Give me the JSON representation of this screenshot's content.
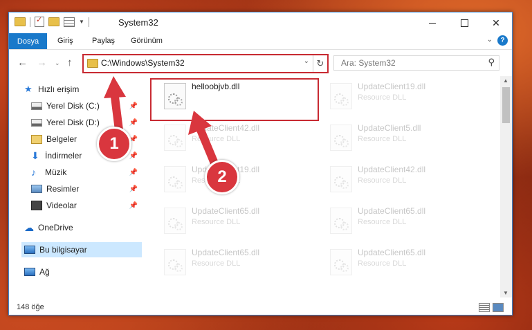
{
  "window": {
    "title": "System32"
  },
  "ribbon": {
    "file_tab": "Dosya",
    "tabs": [
      "Giriş",
      "Paylaş",
      "Görünüm"
    ]
  },
  "address": {
    "path": "C:\\Windows\\System32"
  },
  "search": {
    "placeholder": "Ara: System32"
  },
  "sidebar": {
    "items": [
      {
        "label": "Hızlı erişim",
        "icon": "star-icon",
        "pinned": false
      },
      {
        "label": "Yerel Disk (C:)",
        "icon": "drive-icon",
        "pinned": true
      },
      {
        "label": "Yerel Disk (D:)",
        "icon": "drive-icon",
        "pinned": true
      },
      {
        "label": "Belgeler",
        "icon": "documents-icon",
        "pinned": true
      },
      {
        "label": "İndirmeler",
        "icon": "download-icon",
        "pinned": true
      },
      {
        "label": "Müzik",
        "icon": "music-icon",
        "pinned": true
      },
      {
        "label": "Resimler",
        "icon": "pictures-icon",
        "pinned": true
      },
      {
        "label": "Videolar",
        "icon": "videos-icon",
        "pinned": true
      },
      {
        "label": "OneDrive",
        "icon": "cloud-icon",
        "pinned": false
      },
      {
        "label": "Bu bilgisayar",
        "icon": "computer-icon",
        "pinned": false,
        "selected": true
      },
      {
        "label": "Ağ",
        "icon": "network-icon",
        "pinned": false
      }
    ]
  },
  "files": [
    {
      "name": "helloobjvb.dll",
      "type": "",
      "highlighted": true
    },
    {
      "name": "UpdateClient19.dll",
      "type": "Resource DLL"
    },
    {
      "name": "UpdateClient42.dll",
      "type": "Resource DLL"
    },
    {
      "name": "UpdateClient5.dll",
      "type": "Resource DLL"
    },
    {
      "name": "UpdateClient19.dll",
      "type": "Resource DLL"
    },
    {
      "name": "UpdateClient42.dll",
      "type": "Resource DLL"
    },
    {
      "name": "UpdateClient65.dll",
      "type": "Resource DLL"
    },
    {
      "name": "UpdateClient65.dll",
      "type": "Resource DLL"
    },
    {
      "name": "UpdateClient65.dll",
      "type": "Resource DLL"
    },
    {
      "name": "UpdateClient65.dll",
      "type": "Resource DLL"
    }
  ],
  "status": {
    "item_count": "148 öğe"
  },
  "annotations": {
    "step1": "1",
    "step2": "2",
    "color": "#d9363e"
  }
}
